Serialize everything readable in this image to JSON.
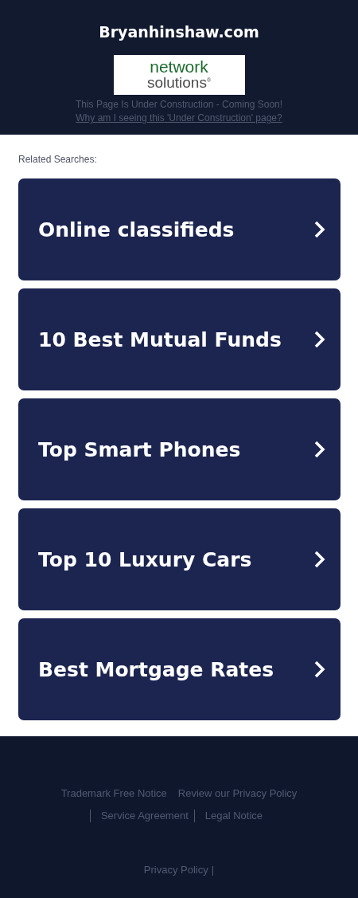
{
  "header": {
    "title": "Bryanhinshaw.com",
    "logo": {
      "line_1": "network",
      "line_2": "solutions",
      "mark": "®"
    },
    "notice": "This Page Is Under Construction - Coming Soon!",
    "link": "Why am I seeing this 'Under Construction' page?"
  },
  "related": {
    "label": "Related Searches:",
    "items": [
      {
        "label": "Online classifieds"
      },
      {
        "label": "10 Best Mutual Funds"
      },
      {
        "label": "Top Smart Phones"
      },
      {
        "label": "Top 10 Luxury Cars"
      },
      {
        "label": "Best Mortgage Rates"
      }
    ]
  },
  "footer": {
    "links": [
      {
        "label": "Trademark Free Notice",
        "divider_before": false
      },
      {
        "label": "Review our Privacy Policy",
        "divider_before": false
      },
      {
        "label": "Service Agreement",
        "divider_before": true
      },
      {
        "label": "Legal Notice",
        "divider_before": true
      }
    ],
    "bottom_link": "Privacy Policy",
    "bottom_separator": "|"
  }
}
